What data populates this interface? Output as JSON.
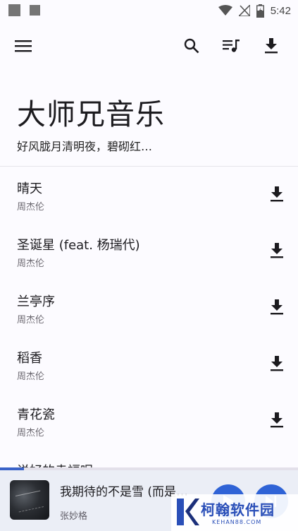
{
  "status_bar": {
    "time": "5:42",
    "icons": [
      "notification-icon",
      "notification-icon",
      "wifi-icon",
      "no-signal-icon",
      "battery-charging-icon"
    ]
  },
  "app_bar": {
    "icons": [
      "menu-icon",
      "search-icon",
      "queue-music-icon",
      "download-icon"
    ]
  },
  "header": {
    "title": "大师兄音乐",
    "subtitle": "好风胧月清明夜，碧砌红…"
  },
  "songs": [
    {
      "title": "晴天",
      "artist": "周杰伦"
    },
    {
      "title": "圣诞星 (feat. 杨瑞代)",
      "artist": "周杰伦"
    },
    {
      "title": "兰亭序",
      "artist": "周杰伦"
    },
    {
      "title": "稻香",
      "artist": "周杰伦"
    },
    {
      "title": "青花瓷",
      "artist": "周杰伦"
    },
    {
      "title": "说好的幸福呢",
      "artist": ""
    }
  ],
  "player": {
    "title": "我期待的不是雪 (而是…",
    "artist": "张妙格",
    "progress": 0.08,
    "icons": [
      "album-art",
      "play-icon",
      "skip-next-icon"
    ]
  },
  "watermark": {
    "text": "柯翰软件园",
    "url": "KEHAN88.COM"
  },
  "colors": {
    "background": "#fcfbff",
    "accent": "#2f63d6",
    "player_background": "#ebeef6"
  }
}
